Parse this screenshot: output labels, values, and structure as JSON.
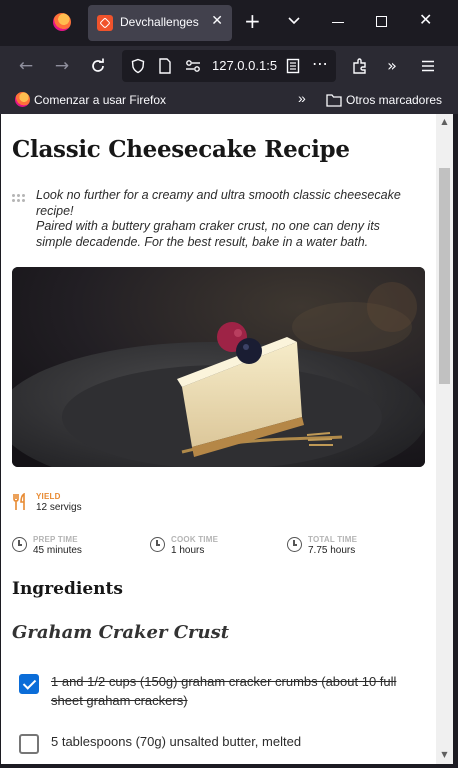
{
  "browser": {
    "tab_title": "Devchallenges",
    "url": "127.0.0.1:5",
    "bookmark_getting_started": "Comenzar a usar Firefox",
    "bookmark_other": "Otros marcadores"
  },
  "recipe": {
    "title": "Classic Cheesecake Recipe",
    "intro": "Look no further for a creamy and ultra smooth classic cheesecake recipe!\nPaired with a buttery graham craker crust, no one can deny its simple decadende. For the best result, bake in a water bath.",
    "yield_label": "YIELD",
    "yield_value": "12 servigs",
    "prep_label": "PREP TIME",
    "prep_value": "45 minutes",
    "cook_label": "COOK TIME",
    "cook_value": "1 hours",
    "total_label": "TOTAL TIME",
    "total_value": "7.75 hours",
    "ingredients_title": "Ingredients",
    "crust_title": "Graham Craker Crust",
    "ingredients": [
      {
        "text": "1 and 1/2 cups (150g) graham cracker crumbs (about 10 full sheet graham crackers)",
        "checked": true
      },
      {
        "text": "5 tablespoons (70g) unsalted butter, melted",
        "checked": false
      }
    ]
  },
  "colors": {
    "accent_orange": "#e88a32",
    "checkbox_blue": "#0b6dd8"
  }
}
